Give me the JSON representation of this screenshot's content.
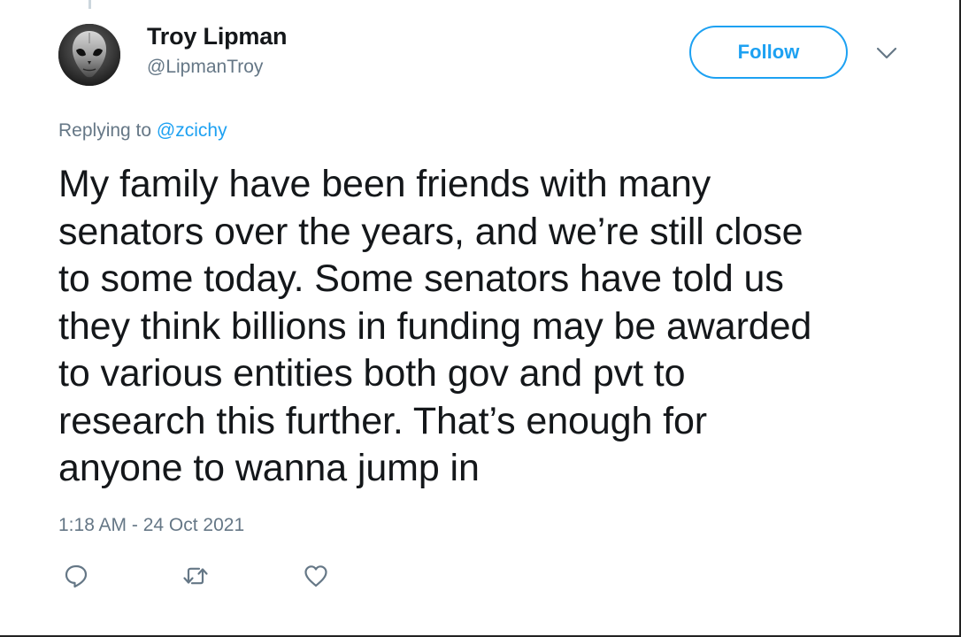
{
  "author": {
    "name": "Troy Lipman",
    "handle": "@LipmanTroy",
    "avatar": "alien-skull-avatar"
  },
  "follow_button": {
    "label": "Follow",
    "color": "#1da1f2"
  },
  "menu": {
    "icon": "chevron-down-icon"
  },
  "reply": {
    "prefix": "Replying to",
    "mention": "@zcichy"
  },
  "tweet": {
    "text": "My family have been friends with many\nsenators over the years, and we’re still close\nto some today. Some senators have told us\nthey think billions in funding may be awarded\nto various entities both gov and pvt to\nresearch this further. That’s enough for\nanyone to wanna jump in",
    "timestamp": "1:18 AM - 24 Oct 2021"
  },
  "actions": [
    {
      "icon": "reply-icon"
    },
    {
      "icon": "retweet-icon"
    },
    {
      "icon": "like-icon"
    }
  ],
  "colors": {
    "text": "#14171a",
    "secondary": "#657786",
    "accent": "#1da1f2"
  }
}
